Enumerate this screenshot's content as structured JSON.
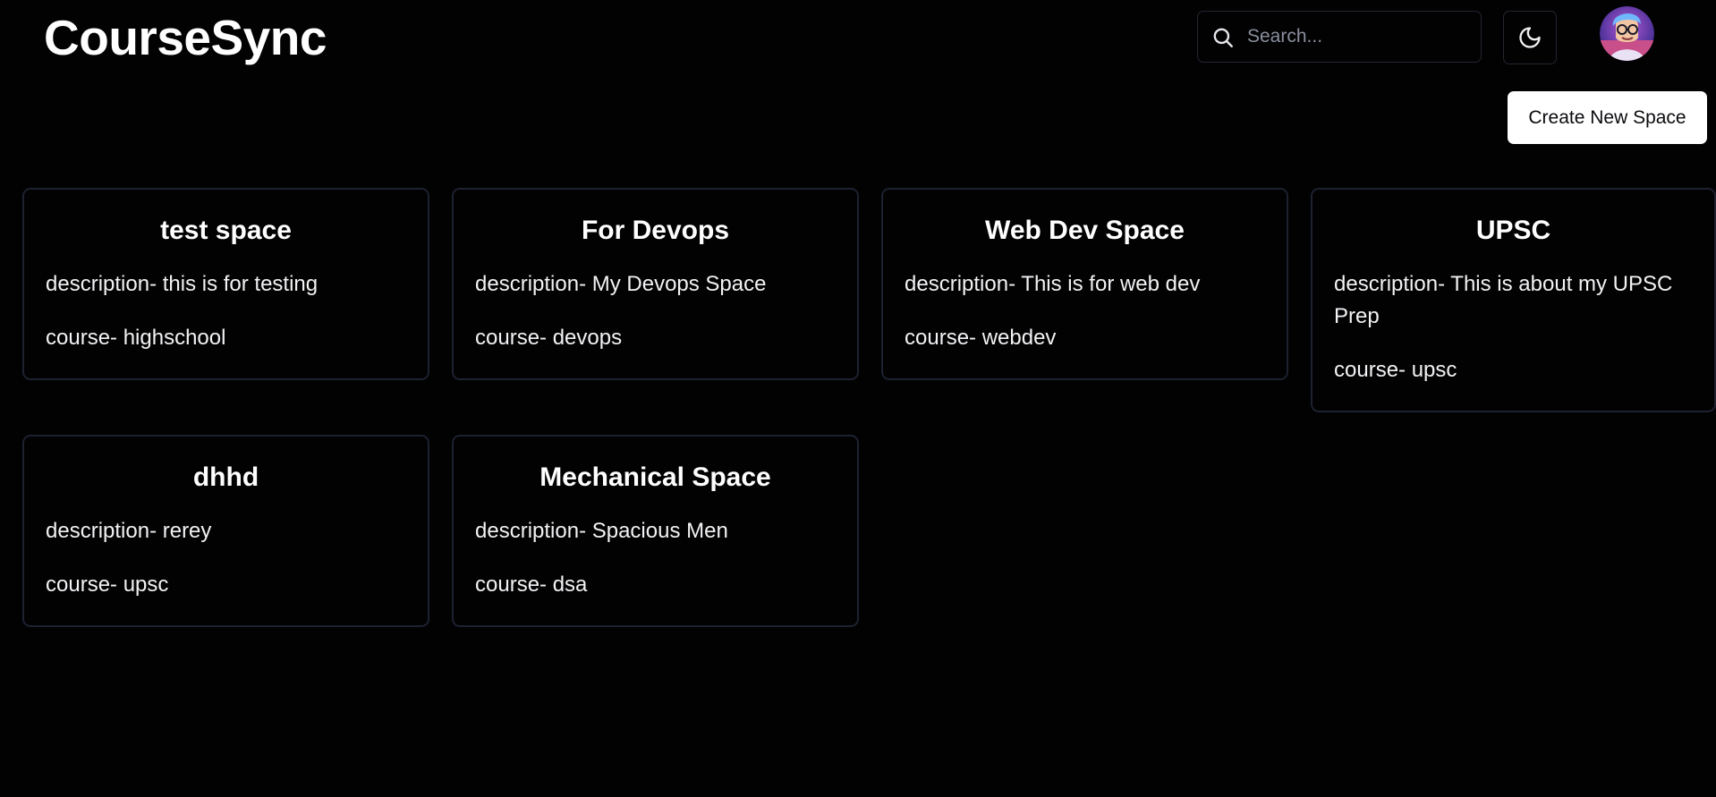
{
  "header": {
    "brand": "CourseSync",
    "search_placeholder": "Search...",
    "search_value": "",
    "theme_icon": "moon-icon",
    "avatar_icon": "avatar-image"
  },
  "actions": {
    "create_label": "Create New Space"
  },
  "spaces": [
    {
      "title": "test space",
      "description": "description- this is for testing",
      "course": "course- highschool"
    },
    {
      "title": "For Devops",
      "description": "description- My Devops Space",
      "course": "course- devops"
    },
    {
      "title": "Web Dev Space",
      "description": "description- This is for web dev",
      "course": "course- webdev"
    },
    {
      "title": "UPSC",
      "description": "description- This is about my UPSC Prep",
      "course": "course- upsc"
    },
    {
      "title": "dhhd",
      "description": "description- rerey",
      "course": "course- upsc"
    },
    {
      "title": "Mechanical Space",
      "description": "description- Spacious Men",
      "course": "course- dsa"
    }
  ],
  "colors": {
    "background": "#020203",
    "card_border": "#1d2130",
    "button_bg": "#ffffff"
  }
}
